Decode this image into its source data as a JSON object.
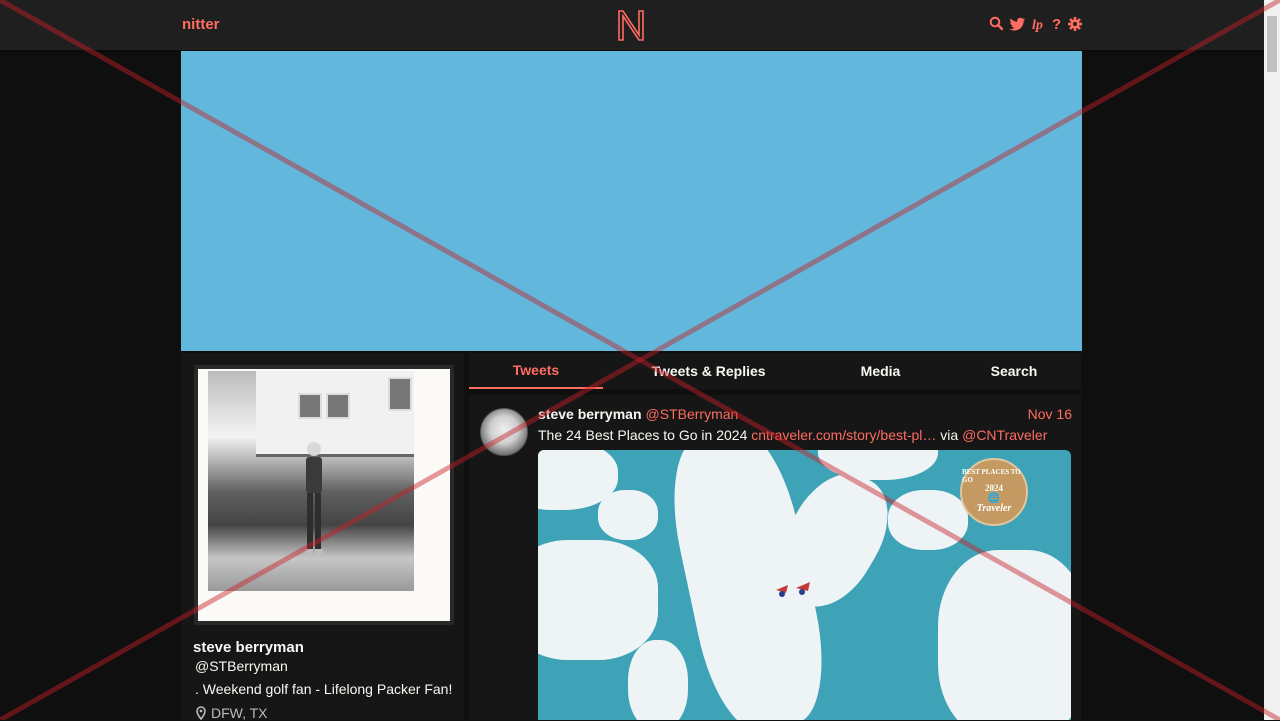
{
  "nav": {
    "brand": "nitter",
    "logo_letter": "N",
    "icons": [
      "search-icon",
      "twitter-bird-icon",
      "lp-icon",
      "help-icon",
      "settings-gear-icon"
    ]
  },
  "colors": {
    "accent": "#ff6c60",
    "banner": "#62b8dc",
    "background": "#0f0f0f",
    "panel": "#161616",
    "navbar": "#1f1f1f"
  },
  "profile": {
    "fullname": "steve berryman",
    "username": "@STBerryman",
    "bio": ". Weekend golf fan - Lifelong Packer Fan!",
    "location": "DFW, TX"
  },
  "tabs": [
    {
      "label": "Tweets",
      "active": true
    },
    {
      "label": "Tweets & Replies",
      "active": false
    },
    {
      "label": "Media",
      "active": false
    },
    {
      "label": "Search",
      "active": false
    }
  ],
  "tweet": {
    "fullname": "steve berryman",
    "username": "@STBerryman",
    "date": "Nov 16",
    "text_prefix": "The 24 Best Places to Go in 2024 ",
    "link": "cntraveler.com/story/best-pl…",
    "text_middle": " via ",
    "mention": "@CNTraveler",
    "badge": {
      "line1": "BEST PLACES TO GO",
      "line2": "2024",
      "line3": "Traveler"
    }
  }
}
